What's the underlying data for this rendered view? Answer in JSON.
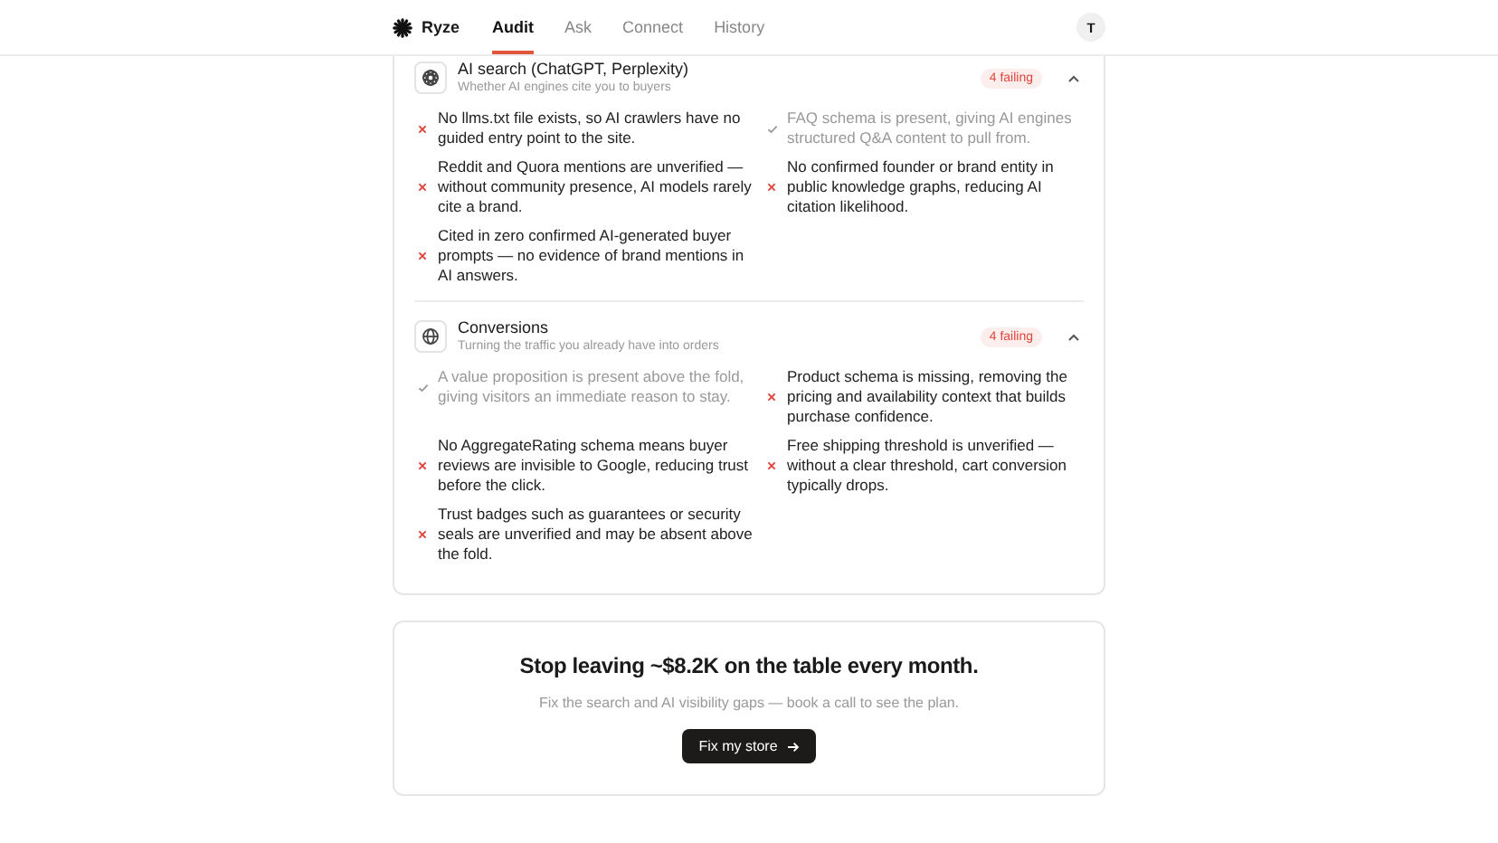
{
  "header": {
    "brand": "Ryze",
    "nav": [
      {
        "label": "Audit",
        "selected": true
      },
      {
        "label": "Ask",
        "selected": false
      },
      {
        "label": "Connect",
        "selected": false
      },
      {
        "label": "History",
        "selected": false
      }
    ],
    "avatar": "T"
  },
  "sections": [
    {
      "kind": "ai",
      "title": "AI search (ChatGPT, Perplexity)",
      "subtitle": "Whether AI engines cite you to buyers",
      "badge": "4 failing",
      "expanded": true,
      "items": [
        {
          "text": "No llms.txt file exists, so AI crawlers have no guided entry point to the site.",
          "passed": false
        },
        {
          "text": "FAQ schema is present, giving AI engines structured Q&A content to pull from.",
          "passed": true
        },
        {
          "text": "Reddit and Quora mentions are unverified — without community presence, AI models rarely cite a brand.",
          "passed": false
        },
        {
          "text": "No confirmed founder or brand entity in public knowledge graphs, reducing AI citation likelihood.",
          "passed": false
        },
        {
          "text": "Cited in zero confirmed AI-generated buyer prompts — no evidence of brand mentions in AI answers.",
          "passed": false
        }
      ]
    },
    {
      "kind": "globe",
      "title": "Conversions",
      "subtitle": "Turning the traffic you already have into orders",
      "badge": "4 failing",
      "expanded": true,
      "items": [
        {
          "text": "A value proposition is present above the fold, giving visitors an immediate reason to stay.",
          "passed": true
        },
        {
          "text": "Product schema is missing, removing the pricing and availability context that builds purchase confidence.",
          "passed": false
        },
        {
          "text": "No AggregateRating schema means buyer reviews are invisible to Google, reducing trust before the click.",
          "passed": false
        },
        {
          "text": "Free shipping threshold is unverified — without a clear threshold, cart conversion typically drops.",
          "passed": false
        },
        {
          "text": "Trust badges such as guarantees or security seals are unverified and may be absent above the fold.",
          "passed": false
        }
      ]
    }
  ],
  "cta": {
    "heading": "Stop leaving ~$8.2K on the table every month.",
    "text": "Fix the search and AI visibility gaps — book a call to see the plan.",
    "button": "Fix my store"
  }
}
